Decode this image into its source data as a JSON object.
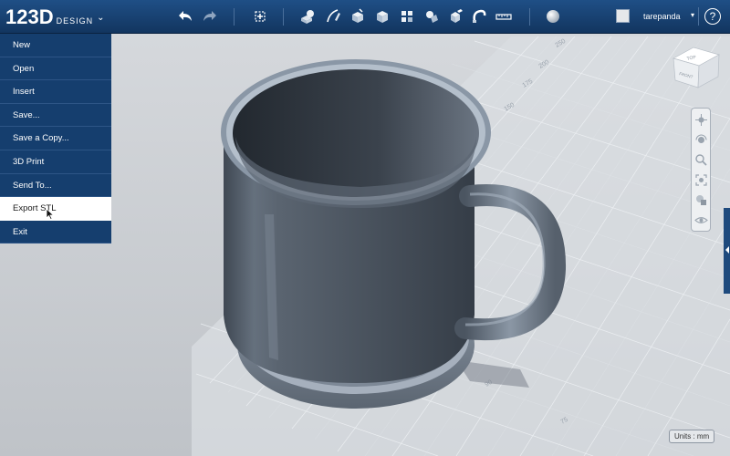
{
  "app": {
    "logo_main": "123D",
    "logo_sub": "DESIGN",
    "logo_chevron": "⌄"
  },
  "toolbar": {
    "icons": [
      "undo-icon",
      "redo-icon",
      "transform-icon",
      "primitives-icon",
      "sketch-icon",
      "construct-icon",
      "modify-icon",
      "pattern-icon",
      "grouping-icon",
      "combine-icon",
      "snap-icon",
      "measure-icon",
      "material-icon"
    ]
  },
  "user": {
    "name": "tarepanda",
    "chevron": "▾",
    "help": "?"
  },
  "menu": {
    "items": [
      {
        "label": "New"
      },
      {
        "label": "Open"
      },
      {
        "label": "Insert"
      },
      {
        "label": "Save..."
      },
      {
        "label": "Save a Copy..."
      },
      {
        "label": "3D Print"
      },
      {
        "label": "Send To..."
      },
      {
        "label": "Export STL"
      },
      {
        "label": "Exit"
      }
    ],
    "active": "Export STL"
  },
  "viewcube": {
    "top": "TOP",
    "front": "FRONT"
  },
  "grid_labels": [
    "250",
    "200",
    "175",
    "150",
    "90",
    "75"
  ],
  "units_label": "Units : mm",
  "colors": {
    "toolbar": "#1a4677",
    "menu": "#153e6e",
    "background": "#c9ccd1",
    "mug": "#4e5866"
  }
}
